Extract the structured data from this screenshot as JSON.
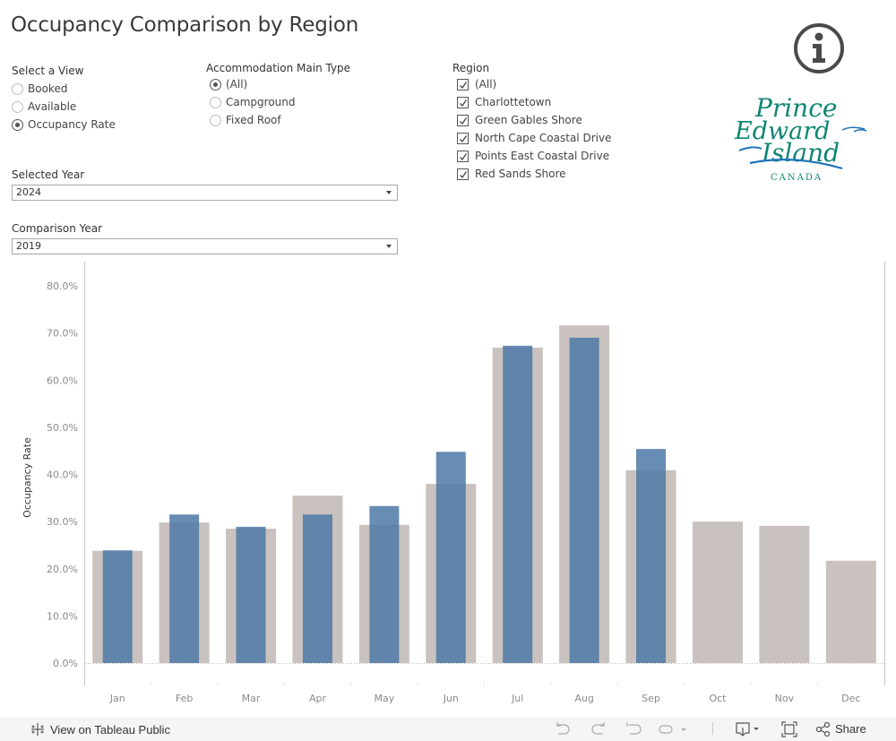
{
  "title": "Occupancy Comparison by Region",
  "view_filter": {
    "label": "Select a View",
    "options": [
      {
        "label": "Booked",
        "selected": false
      },
      {
        "label": "Available",
        "selected": false
      },
      {
        "label": "Occupancy Rate",
        "selected": true
      }
    ]
  },
  "accommodation_filter": {
    "label": "Accommodation Main Type",
    "options": [
      {
        "label": "(All)",
        "selected": true
      },
      {
        "label": "Campground",
        "selected": false
      },
      {
        "label": "Fixed Roof",
        "selected": false
      }
    ]
  },
  "region_filter": {
    "label": "Region",
    "options": [
      {
        "label": "(All)",
        "checked": true
      },
      {
        "label": "Charlottetown",
        "checked": true
      },
      {
        "label": "Green Gables Shore",
        "checked": true
      },
      {
        "label": "North Cape Coastal Drive",
        "checked": true
      },
      {
        "label": "Points East Coastal Drive",
        "checked": true
      },
      {
        "label": "Red Sands Shore",
        "checked": true
      }
    ]
  },
  "selected_year": {
    "label": "Selected Year",
    "value": "2024"
  },
  "comparison_year": {
    "label": "Comparison Year",
    "value": "2019"
  },
  "logo": {
    "line1": "Prince",
    "line2": "Edward",
    "line3": "Island",
    "line4": "CANADA",
    "color": "#0e8572",
    "wave_color": "#1e74b8"
  },
  "colors": {
    "selected": "#4e79a7",
    "comparison": "#c9c2be",
    "axis_text": "#8a8a8a"
  },
  "chart_data": {
    "type": "bar",
    "title": "",
    "xlabel": "",
    "ylabel": "Occupancy Rate",
    "ylim": [
      0,
      80
    ],
    "yticks": [
      0,
      10,
      20,
      30,
      40,
      50,
      60,
      70,
      80
    ],
    "ytick_labels": [
      "0.0%",
      "10.0%",
      "20.0%",
      "30.0%",
      "40.0%",
      "50.0%",
      "60.0%",
      "70.0%",
      "80.0%"
    ],
    "categories": [
      "Jan",
      "Feb",
      "Mar",
      "Apr",
      "May",
      "Jun",
      "Jul",
      "Aug",
      "Sep",
      "Oct",
      "Nov",
      "Dec"
    ],
    "grid": false,
    "series": [
      {
        "name": "Comparison Year (2019)",
        "values": [
          23.8,
          29.8,
          28.5,
          35.5,
          29.3,
          38.0,
          66.9,
          71.6,
          40.9,
          30.0,
          29.1,
          21.7
        ]
      },
      {
        "name": "Selected Year (2024)",
        "values": [
          23.9,
          31.5,
          28.9,
          31.5,
          33.3,
          44.8,
          67.3,
          69.0,
          45.4,
          null,
          null,
          null
        ]
      }
    ]
  },
  "footer": {
    "view_on_label": "View on Tableau Public",
    "share_label": "Share"
  }
}
